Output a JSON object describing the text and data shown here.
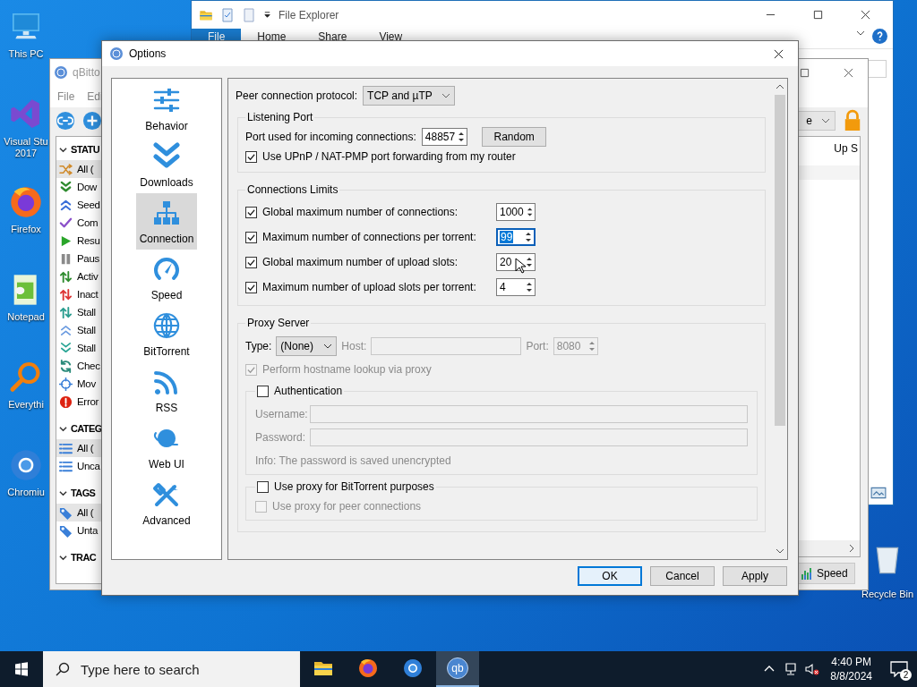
{
  "desktop_icons": [
    {
      "label": "This PC",
      "kind": "computer"
    },
    {
      "label": "Visual Stu 2017",
      "kind": "visual-studio"
    },
    {
      "label": "Firefox",
      "kind": "firefox"
    },
    {
      "label": "Notepad",
      "kind": "notepad"
    },
    {
      "label": "Everythi",
      "kind": "everything"
    },
    {
      "label": "Chromiu",
      "kind": "chromium"
    }
  ],
  "recycle_bin": {
    "label": "Recycle Bin"
  },
  "file_explorer": {
    "title": "File Explorer",
    "ribbon_tabs": [
      {
        "label": "File",
        "selected": true
      },
      {
        "label": "Home",
        "selected": false
      },
      {
        "label": "Share",
        "selected": false
      },
      {
        "label": "View",
        "selected": false
      }
    ]
  },
  "qbittorrent": {
    "title": "qBitto",
    "menu": [
      "File",
      "Edi"
    ],
    "filter_value": "e",
    "column_header": "Up S",
    "speed_button": "Speed",
    "sidebar": [
      {
        "heading": "STATU",
        "expanded": true,
        "items": [
          {
            "label": "All (",
            "kind": "all",
            "selected": true
          },
          {
            "label": "Dow",
            "kind": "download",
            "selected": false
          },
          {
            "label": "Seed",
            "kind": "seed",
            "selected": false
          },
          {
            "label": "Com",
            "kind": "complete",
            "selected": false
          },
          {
            "label": "Resu",
            "kind": "resume",
            "selected": false
          },
          {
            "label": "Paus",
            "kind": "pause",
            "selected": false
          },
          {
            "label": "Activ",
            "kind": "active",
            "selected": false
          },
          {
            "label": "Inact",
            "kind": "inactive",
            "selected": false
          },
          {
            "label": "Stall",
            "kind": "stalled",
            "selected": false
          },
          {
            "label": "Stall",
            "kind": "stalled-up",
            "selected": false
          },
          {
            "label": "Stall",
            "kind": "stalled-down",
            "selected": false
          },
          {
            "label": "Chec",
            "kind": "checking",
            "selected": false
          },
          {
            "label": "Mov",
            "kind": "moving",
            "selected": false
          },
          {
            "label": "Error",
            "kind": "error",
            "selected": false
          }
        ]
      },
      {
        "heading": "CATEG",
        "expanded": true,
        "items": [
          {
            "label": "All (",
            "kind": "list",
            "selected": true
          },
          {
            "label": "Unca",
            "kind": "list",
            "selected": false
          }
        ]
      },
      {
        "heading": "TAGS",
        "expanded": true,
        "items": [
          {
            "label": "All (",
            "kind": "tag",
            "selected": true
          },
          {
            "label": "Unta",
            "kind": "tag",
            "selected": false
          }
        ]
      },
      {
        "heading": "TRAC",
        "expanded": true
      }
    ]
  },
  "options": {
    "title": "Options",
    "categories": [
      {
        "label": "Behavior",
        "kind": "sliders",
        "selected": false
      },
      {
        "label": "Downloads",
        "kind": "chevrons",
        "selected": false
      },
      {
        "label": "Connection",
        "kind": "network",
        "selected": true
      },
      {
        "label": "Speed",
        "kind": "gauge",
        "selected": false
      },
      {
        "label": "BitTorrent",
        "kind": "globe",
        "selected": false
      },
      {
        "label": "RSS",
        "kind": "rss",
        "selected": false
      },
      {
        "label": "Web UI",
        "kind": "planet",
        "selected": false
      },
      {
        "label": "Advanced",
        "kind": "tools",
        "selected": false
      }
    ],
    "peer_protocol": {
      "label": "Peer connection protocol:",
      "value": "TCP and µTP"
    },
    "listening_port": {
      "title": "Listening Port",
      "port_label": "Port used for incoming connections:",
      "port_value": "48857",
      "random_button": "Random",
      "upnp": {
        "label": "Use UPnP / NAT-PMP port forwarding from my router",
        "checked": true
      }
    },
    "connection_limits": {
      "title": "Connections Limits",
      "rows": [
        {
          "label": "Global maximum number of connections:",
          "checked": true,
          "value": "1000",
          "focused": false
        },
        {
          "label": "Maximum number of connections per torrent:",
          "checked": true,
          "value": "99",
          "focused": true
        },
        {
          "label": "Global maximum number of upload slots:",
          "checked": true,
          "value": "20",
          "focused": false
        },
        {
          "label": "Maximum number of upload slots per torrent:",
          "checked": true,
          "value": "4",
          "focused": false
        }
      ]
    },
    "proxy": {
      "title": "Proxy Server",
      "type_label": "Type:",
      "type_value": "(None)",
      "host": {
        "label": "Host:",
        "disabled": true
      },
      "port": {
        "label": "Port:",
        "value": "8080",
        "disabled": true
      },
      "hostname_lookup": {
        "label": "Perform hostname lookup via proxy",
        "checked": true,
        "disabled": true
      },
      "authentication": {
        "label": "Authentication",
        "checked": false
      },
      "username": {
        "label": "Username:",
        "disabled": true
      },
      "password": {
        "label": "Password:",
        "disabled": true
      },
      "info": {
        "text": "Info: The password is saved unencrypted",
        "disabled": true
      },
      "bittorrent": {
        "label": "Use proxy for BitTorrent purposes",
        "checked": false
      },
      "peer_connections": {
        "label": "Use proxy for peer connections",
        "checked": false,
        "disabled": true
      }
    },
    "buttons": [
      {
        "label": "OK",
        "default": true
      },
      {
        "label": "Cancel",
        "default": false
      },
      {
        "label": "Apply",
        "default": false
      }
    ]
  },
  "taskbar": {
    "search_placeholder": "Type here to search",
    "apps": [
      {
        "kind": "explorer",
        "active": false
      },
      {
        "kind": "firefox",
        "active": false
      },
      {
        "kind": "chromium",
        "active": false
      },
      {
        "kind": "qbittorrent",
        "active": true,
        "logo_text": "qb"
      }
    ],
    "time": "4:40 PM",
    "date": "8/8/2024",
    "notifications": "2"
  }
}
